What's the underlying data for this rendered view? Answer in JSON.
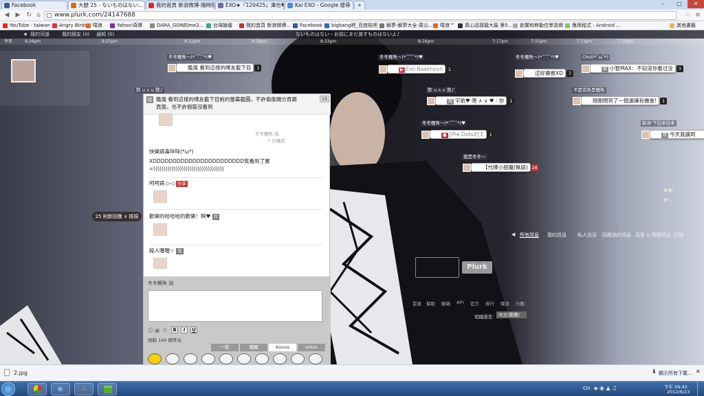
{
  "browser": {
    "tabs": [
      {
        "label": "Facebook",
        "color": "#3b5998"
      },
      {
        "label": "大腿 25 - ないものはない...",
        "color": "#e06b1e"
      },
      {
        "label": "我的首頁 新浪微博-隨時隨...",
        "color": "#d0302b"
      },
      {
        "label": "EXO★『120425』澤也♥ 些...",
        "color": "#6d6d9e"
      },
      {
        "label": "Kai EXO - Google 搜尋",
        "color": "#4a89dc"
      }
    ],
    "url": "www.plurk.com/24147688",
    "bookmarks": [
      {
        "label": "YouTube - taiwan",
        "color": "#e22"
      },
      {
        "label": "Angry Birds",
        "color": "#d33"
      },
      {
        "label": "噗浪",
        "color": "#e06b1e"
      },
      {
        "label": "Yahoo!奇摩",
        "color": "#7b2fa0"
      },
      {
        "label": "DARA_GON的me2...",
        "color": "#888"
      },
      {
        "label": "台灣論壇",
        "color": "#3a8"
      },
      {
        "label": "我的首頁 新浪微博...",
        "color": "#d0302b"
      },
      {
        "label": "Facebook",
        "color": "#3b5998"
      },
      {
        "label": "bigbang吧_百度貼吧",
        "color": "#36c"
      },
      {
        "label": "解夢-解夢大全-周公...",
        "color": "#777"
      },
      {
        "label": "噗浪™",
        "color": "#e06b1e"
      },
      {
        "label": "真心話接龍大篇 第5...",
        "color": "#333"
      },
      {
        "label": "創業和移動住學習網",
        "color": "#aaa"
      },
      {
        "label": "應用程式 - Android ...",
        "color": "#8c4"
      }
    ],
    "other_bookmarks": "其他書籤",
    "page_title_line": "ないものはない・お前にまだ渡すものはないよ♪"
  },
  "plurk": {
    "nav": [
      "我的河道",
      "我的朋友 (0)",
      "通知 (0)"
    ],
    "timeline": [
      "9:26pm",
      "9:25pm",
      "8:32pm",
      "8:28pm",
      "8:23pm",
      "8:16pm",
      "7:17pm",
      "7:15pm",
      "7:13pm",
      "7:10pm"
    ],
    "day_label": "今天",
    "bubbles": [
      {
        "user": "冬冬鯉魚～(*ˇ⌒ˇ*)♥",
        "text": "鑑風 看到這樣的噗友截下目",
        "count": "1"
      },
      {
        "user": "冬冬鯉魚～(*ˇ⌒ˇ*)♥",
        "text": "Exo Baekhyun",
        "count": "1"
      },
      {
        "user": "冬冬鯉魚～(*ˇ⌒ˇ*)♥",
        "text": "這好療癒XD",
        "count": "7"
      },
      {
        "user": "Choi(*ˇωˇ*)",
        "text": "小智MAX：不知道你看过沒",
        "count": "3"
      },
      {
        "user": "默 ∪ ʌ ∪ 默♪",
        "text": "宇航♥ 嗯 ∧ ∨ ♥ : 你",
        "count": "1"
      },
      {
        "user": "不是花魚是鯉魚",
        "text": "剛剛問到了一個選擇有機會!",
        "count": "1"
      },
      {
        "user": "冬冬鯉魚～(*ˇ⌒ˇ*)♥",
        "text": "[Pre Debut] E",
        "count": "1"
      },
      {
        "user": "歐洲·下記本記本",
        "text": "今天我講到",
        "count": "1"
      },
      {
        "user": "我是冬冬～",
        "text": "【代噗小惡魔(無誤)",
        "count": "28"
      }
    ],
    "responses_count": "25 則新回應 ∨ 檢視",
    "tag_qiqi": "說",
    "filters": [
      "所有訊息",
      "我的訊息",
      "私人訊息",
      "回應過的訊息",
      "喜愛 & 轉噗訊息",
      "已讀"
    ],
    "plurk_button": "Plurk",
    "footer_links": [
      "首頁",
      "幫助",
      "聯絡",
      "API",
      "官方",
      "排行",
      "噗浪",
      "行動"
    ],
    "lang_label": "切換語言:",
    "lang_value": "中文(繁體)"
  },
  "panel": {
    "header_text": "鑑風 看到這樣的噗友截下目前的螢幕截圖，不許偷偷關分頁跟頁面，也不許假裝沒看到",
    "header_count": "15",
    "meta_time": "7 分鐘前",
    "meta_user": "冬冬鯉魚 說",
    "responses": [
      {
        "text": "快樂病毒咩咩(*ω*)",
        "sub": "XDDDDDDDDDDDDDDDDDDDDDDD笑看到了實",
        "sub2": "=)))))))))))))))))))))))))))))))))))"
      },
      {
        "text": "呵呵病 ▷◁",
        "tag": "分享"
      },
      {
        "text": "歡樂的哈哈哈的歡樂！啊♥",
        "tag": "說"
      },
      {
        "text": "殺人喔喔☆",
        "tag": "說"
      }
    ],
    "composer_label": "冬冬鯉魚 說",
    "char_count": "尚餘 140 個字元",
    "format_buttons": [
      "B",
      "I",
      "U"
    ],
    "emoji_tabs": [
      "一般",
      "隱藏",
      "bonus",
      "emos"
    ]
  },
  "download_bar": {
    "file": "2.jpg",
    "show_all": "顯示所有下載..."
  },
  "taskbar": {
    "lang": "CH",
    "time": "下午 09:43",
    "date": "2012/6/23"
  },
  "colors": {
    "accent": "#e06b1e",
    "page_title": "#dddddd"
  }
}
